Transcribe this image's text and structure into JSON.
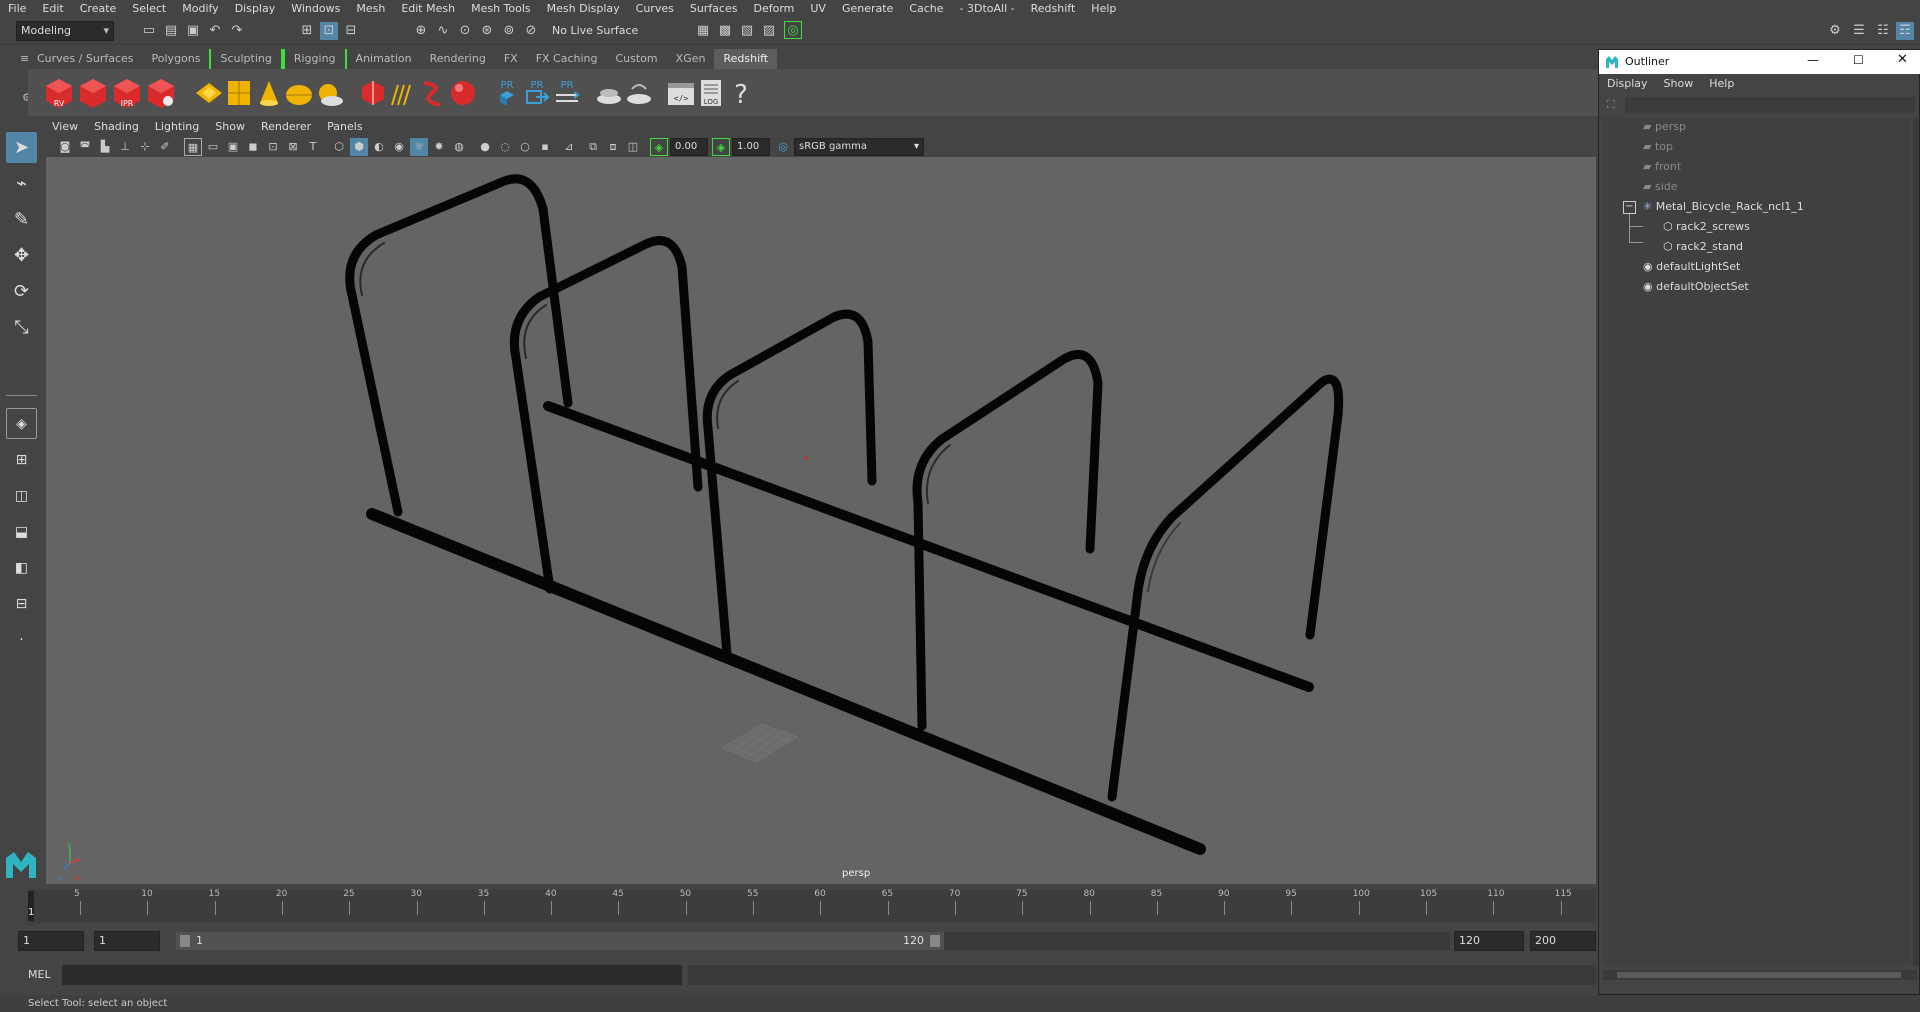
{
  "menubar": [
    "File",
    "Edit",
    "Create",
    "Select",
    "Modify",
    "Display",
    "Windows",
    "Mesh",
    "Edit Mesh",
    "Mesh Tools",
    "Mesh Display",
    "Curves",
    "Surfaces",
    "Deform",
    "UV",
    "Generate",
    "Cache",
    "- 3DtoAll -",
    "Redshift",
    "Help"
  ],
  "status": {
    "workspace": "Modeling",
    "live_surface": "No Live Surface"
  },
  "shelf_tabs": [
    "Curves / Surfaces",
    "Polygons",
    "Sculpting",
    "Rigging",
    "Animation",
    "Rendering",
    "FX",
    "FX Caching",
    "Custom",
    "XGen",
    "Redshift"
  ],
  "shelf_active": "Redshift",
  "shelf_labels": {
    "rv": "RV",
    "ipr": "IPR",
    "pr": "PR",
    "log": "LOG",
    "help": "?"
  },
  "panel_menu": [
    "View",
    "Shading",
    "Lighting",
    "Show",
    "Renderer",
    "Panels"
  ],
  "viewbar": {
    "exposure": "0.00",
    "gamma": "1.00",
    "color_space": "sRGB gamma"
  },
  "viewport": {
    "camera_label": "persp",
    "axes": {
      "x": "x",
      "y": "y",
      "z": "z"
    }
  },
  "timeline": {
    "ticks": [
      "5",
      "10",
      "15",
      "20",
      "25",
      "30",
      "35",
      "40",
      "45",
      "50",
      "55",
      "60",
      "65",
      "70",
      "75",
      "80",
      "85",
      "90",
      "95",
      "100",
      "105",
      "110",
      "115"
    ],
    "current_frame": "1"
  },
  "range": {
    "start": "1",
    "anim_start": "1",
    "range_start": "1",
    "range_end": "120",
    "anim_end": "120",
    "end": "200"
  },
  "cmd": {
    "label": "MEL"
  },
  "help_line": "Select Tool: select an object",
  "outliner": {
    "title": "Outliner",
    "menu": [
      "Display",
      "Show",
      "Help"
    ],
    "items": [
      {
        "label": "persp",
        "dim": true
      },
      {
        "label": "top",
        "dim": true
      },
      {
        "label": "front",
        "dim": true
      },
      {
        "label": "side",
        "dim": true
      },
      {
        "label": "Metal_Bicycle_Rack_ncl1_1",
        "dim": false
      },
      {
        "label": "rack2_screws",
        "dim": false
      },
      {
        "label": "rack2_stand",
        "dim": false
      },
      {
        "label": "defaultLightSet",
        "dim": false
      },
      {
        "label": "defaultObjectSet",
        "dim": false
      }
    ]
  },
  "colors": {
    "accent": "#5285a6",
    "shelf_green": "#3fdc3f",
    "render_red": "#d92b2b",
    "pr_blue": "#3aa0d8",
    "yellow": "#f0b400"
  }
}
